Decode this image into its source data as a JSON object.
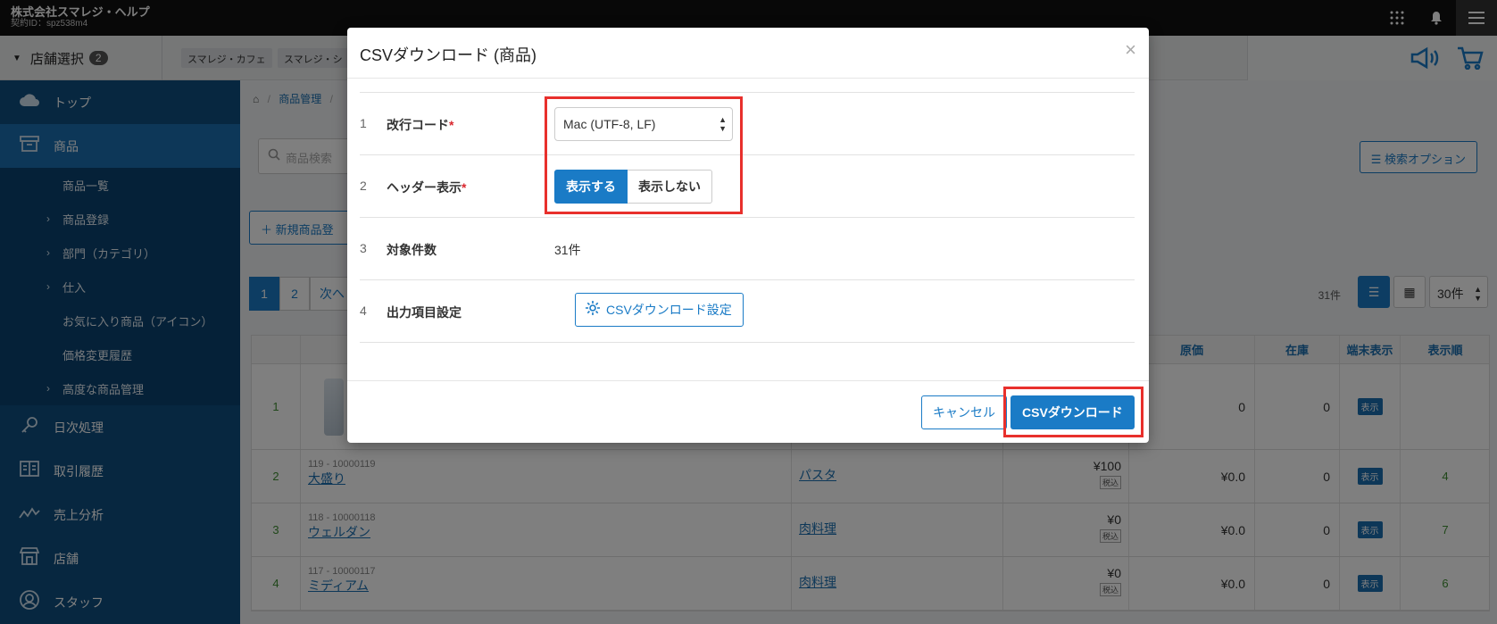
{
  "topbar": {
    "company": "株式会社スマレジ・ヘルプ",
    "contract_id": "契約ID：spz538m4",
    "icons": [
      "apps-grid-icon",
      "bell-icon",
      "hamburger-menu-icon"
    ]
  },
  "storebar": {
    "select_label": "店舗選択",
    "select_count": "2",
    "chips": [
      "スマレジ・カフェ",
      "スマレジ・シ"
    ],
    "icons": [
      "megaphone-icon",
      "cart-icon"
    ]
  },
  "sidebar": {
    "items": [
      {
        "label": "トップ",
        "icon": "cloud-icon"
      },
      {
        "label": "商品",
        "icon": "box-icon"
      },
      {
        "label": "日次処理",
        "icon": "key-icon"
      },
      {
        "label": "取引履歴",
        "icon": "book-icon"
      },
      {
        "label": "売上分析",
        "icon": "line-chart-icon"
      },
      {
        "label": "店舗",
        "icon": "store-icon"
      },
      {
        "label": "スタッフ",
        "icon": "user-icon"
      }
    ],
    "sub_items": [
      {
        "label": "商品一覧",
        "expandable": false
      },
      {
        "label": "商品登録",
        "expandable": true
      },
      {
        "label": "部門（カテゴリ）",
        "expandable": true
      },
      {
        "label": "仕入",
        "expandable": true
      },
      {
        "label": "お気に入り商品（アイコン）",
        "expandable": false
      },
      {
        "label": "価格変更履歴",
        "expandable": false
      },
      {
        "label": "高度な商品管理",
        "expandable": true
      }
    ]
  },
  "main": {
    "breadcrumb": [
      "商品管理",
      "/"
    ],
    "search_placeholder": "商品検索",
    "search_options": "検索オプション",
    "new_product": "新規商品登",
    "pages": [
      "1",
      "2",
      "次へ"
    ],
    "total_count": "31件",
    "per_page": "30件",
    "table": {
      "headers": {
        "cost": "原価",
        "stock": "在庫",
        "display": "端末表示",
        "order": "表示順"
      },
      "rows": [
        {
          "no": "1",
          "code": "",
          "name": "",
          "category": "",
          "price": "",
          "tax": "",
          "cost": "0",
          "stock": "0",
          "display": "表示",
          "order": ""
        },
        {
          "no": "2",
          "code": "119 - 10000119",
          "name": "大盛り",
          "category": "パスタ",
          "price": "¥100",
          "tax": "税込",
          "cost": "¥0.0",
          "stock": "0",
          "display": "表示",
          "order": "4"
        },
        {
          "no": "3",
          "code": "118 - 10000118",
          "name": "ウェルダン",
          "category": "肉料理",
          "price": "¥0",
          "tax": "税込",
          "cost": "¥0.0",
          "stock": "0",
          "display": "表示",
          "order": "7"
        },
        {
          "no": "4",
          "code": "117 - 10000117",
          "name": "ミディアム",
          "category": "肉料理",
          "price": "¥0",
          "tax": "税込",
          "cost": "¥0.0",
          "stock": "0",
          "display": "表示",
          "order": "6"
        }
      ]
    }
  },
  "modal": {
    "title": "CSVダウンロード (商品)",
    "close": "×",
    "rows": [
      {
        "num": "1",
        "label": "改行コード",
        "required": "*",
        "value": "Mac (UTF-8, LF)"
      },
      {
        "num": "2",
        "label": "ヘッダー表示",
        "required": "*",
        "on": "表示する",
        "off": "表示しない"
      },
      {
        "num": "3",
        "label": "対象件数",
        "value": "31件"
      },
      {
        "num": "4",
        "label": "出力項目設定",
        "button": "CSVダウンロード設定"
      }
    ],
    "cancel": "キャンセル",
    "download": "CSVダウンロード"
  },
  "colors": {
    "primary": "#1a7bc6",
    "sidebar": "#0e4f80",
    "highlight": "#e8302c"
  }
}
